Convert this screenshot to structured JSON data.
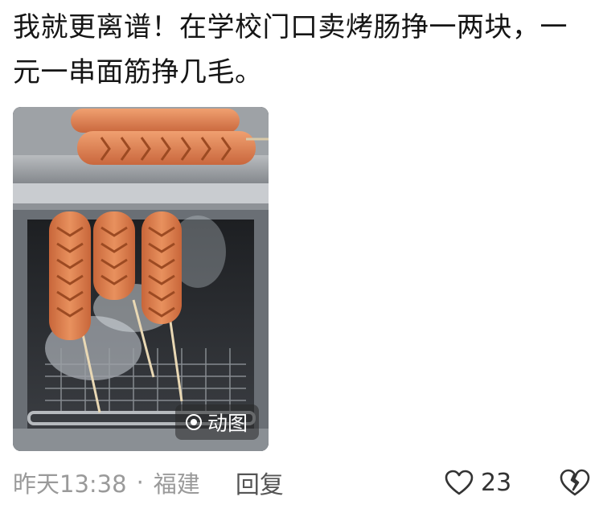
{
  "comment": {
    "text": "我就更离谱！在学校门口卖烤肠挣一两块，一元一串面筋挣几毛。"
  },
  "media": {
    "badge_icon": "gif-play-icon",
    "badge_label": "动图"
  },
  "meta": {
    "time": "昨天13:38",
    "separator": "·",
    "location": "福建",
    "reply_label": "回复",
    "like_icon": "heart-icon",
    "like_count": "23",
    "dislike_icon": "broken-heart-icon"
  },
  "colors": {
    "meta_text": "#9a9a9a",
    "body_text": "#151515"
  }
}
